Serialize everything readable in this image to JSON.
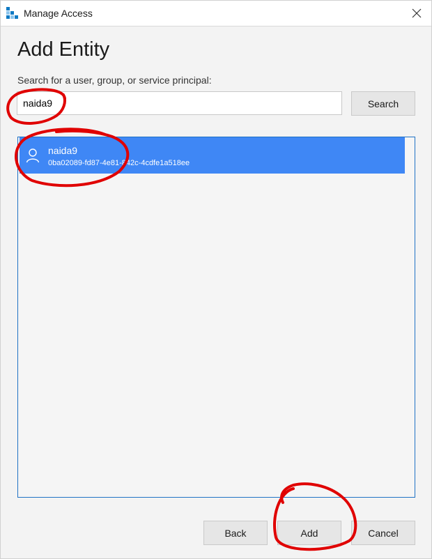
{
  "window": {
    "title": "Manage Access"
  },
  "dialog": {
    "heading": "Add Entity",
    "search_label": "Search for a user, group, or service principal:",
    "search_value": "naida9",
    "search_button": "Search"
  },
  "results": [
    {
      "name": "naida9",
      "id": "0ba02089-fd87-4e81-842c-4cdfe1a518ee",
      "icon": "user-icon",
      "selected": true
    }
  ],
  "footer": {
    "back_label": "Back",
    "add_label": "Add",
    "cancel_label": "Cancel"
  },
  "colors": {
    "selection": "#3f87f5",
    "list_border": "#1f72c4",
    "annotation": "#e00000"
  }
}
